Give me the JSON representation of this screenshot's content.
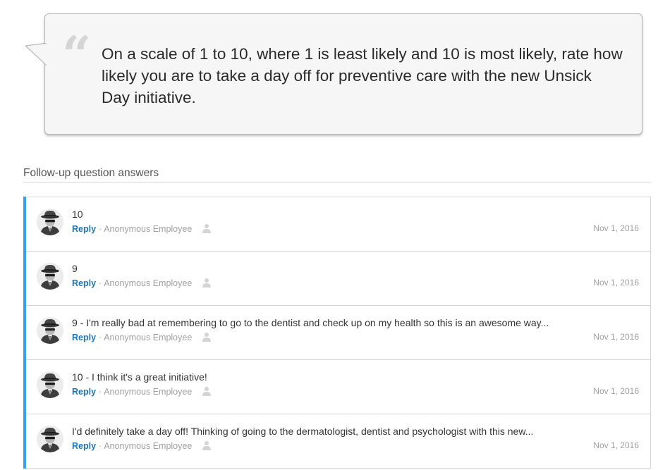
{
  "question": {
    "quote_glyph": "“",
    "text": "On a scale of 1 to 10, where 1 is least likely and 10 is most likely, rate how likely you are to take a day off for preventive care with the new Unsick Day initiative."
  },
  "followup_section": {
    "title": "Follow-up question answers"
  },
  "answers": [
    {
      "text": "10",
      "reply_label": "Reply",
      "separator": "·",
      "author": "Anonymous Employee",
      "date": "Nov 1, 2016"
    },
    {
      "text": "9",
      "reply_label": "Reply",
      "separator": "·",
      "author": "Anonymous Employee",
      "date": "Nov 1, 2016"
    },
    {
      "text": "9 - I'm really bad at remembering to go to the dentist and check up on my health so this is an awesome way...",
      "reply_label": "Reply",
      "separator": "·",
      "author": "Anonymous Employee",
      "date": "Nov 1, 2016"
    },
    {
      "text": "10 - I think it's a great initiative!",
      "reply_label": "Reply",
      "separator": "·",
      "author": "Anonymous Employee",
      "date": "Nov 1, 2016"
    },
    {
      "text": "I'd definitely take a day off! Thinking of going to the dermatologist, dentist and psychologist with this new...",
      "reply_label": "Reply",
      "separator": "·",
      "author": "Anonymous Employee",
      "date": "Nov 1, 2016"
    }
  ],
  "colors": {
    "accent_bar": "#3aa0f0",
    "reply_link": "#1e74b8",
    "bubble_bg": "#f6f6f6"
  },
  "icons": {
    "avatar": "anonymous-spy-avatar-icon",
    "quote": "open-quote-icon",
    "author_badge": "anonymous-person-icon"
  }
}
